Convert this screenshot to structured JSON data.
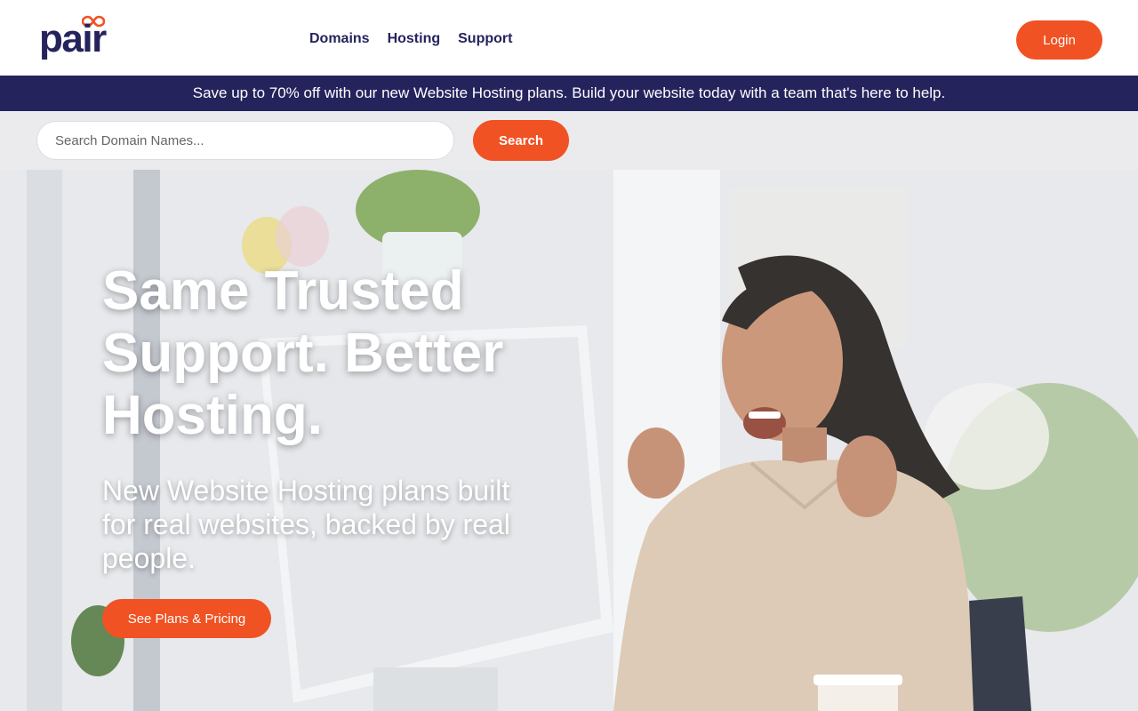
{
  "header": {
    "logo_text": "pair",
    "nav": [
      {
        "label": "Domains"
      },
      {
        "label": "Hosting"
      },
      {
        "label": "Support"
      }
    ],
    "login_label": "Login"
  },
  "promo": {
    "text": "Save up to 70% off with our new Website Hosting plans. Build your website today with a team that's here to help."
  },
  "search": {
    "placeholder": "Search Domain Names...",
    "value": "",
    "button_label": "Search"
  },
  "hero": {
    "title": "Same Trusted Support. Better Hosting.",
    "subtitle": "New Website Hosting plans built for real websites, backed by real people.",
    "cta_label": "See Plans & Pricing",
    "image_description_icon": "photo-woman-celebrating-at-computer"
  },
  "colors": {
    "brand_navy": "#25235c",
    "brand_orange": "#f05223",
    "search_row_bg": "#ebebee"
  }
}
